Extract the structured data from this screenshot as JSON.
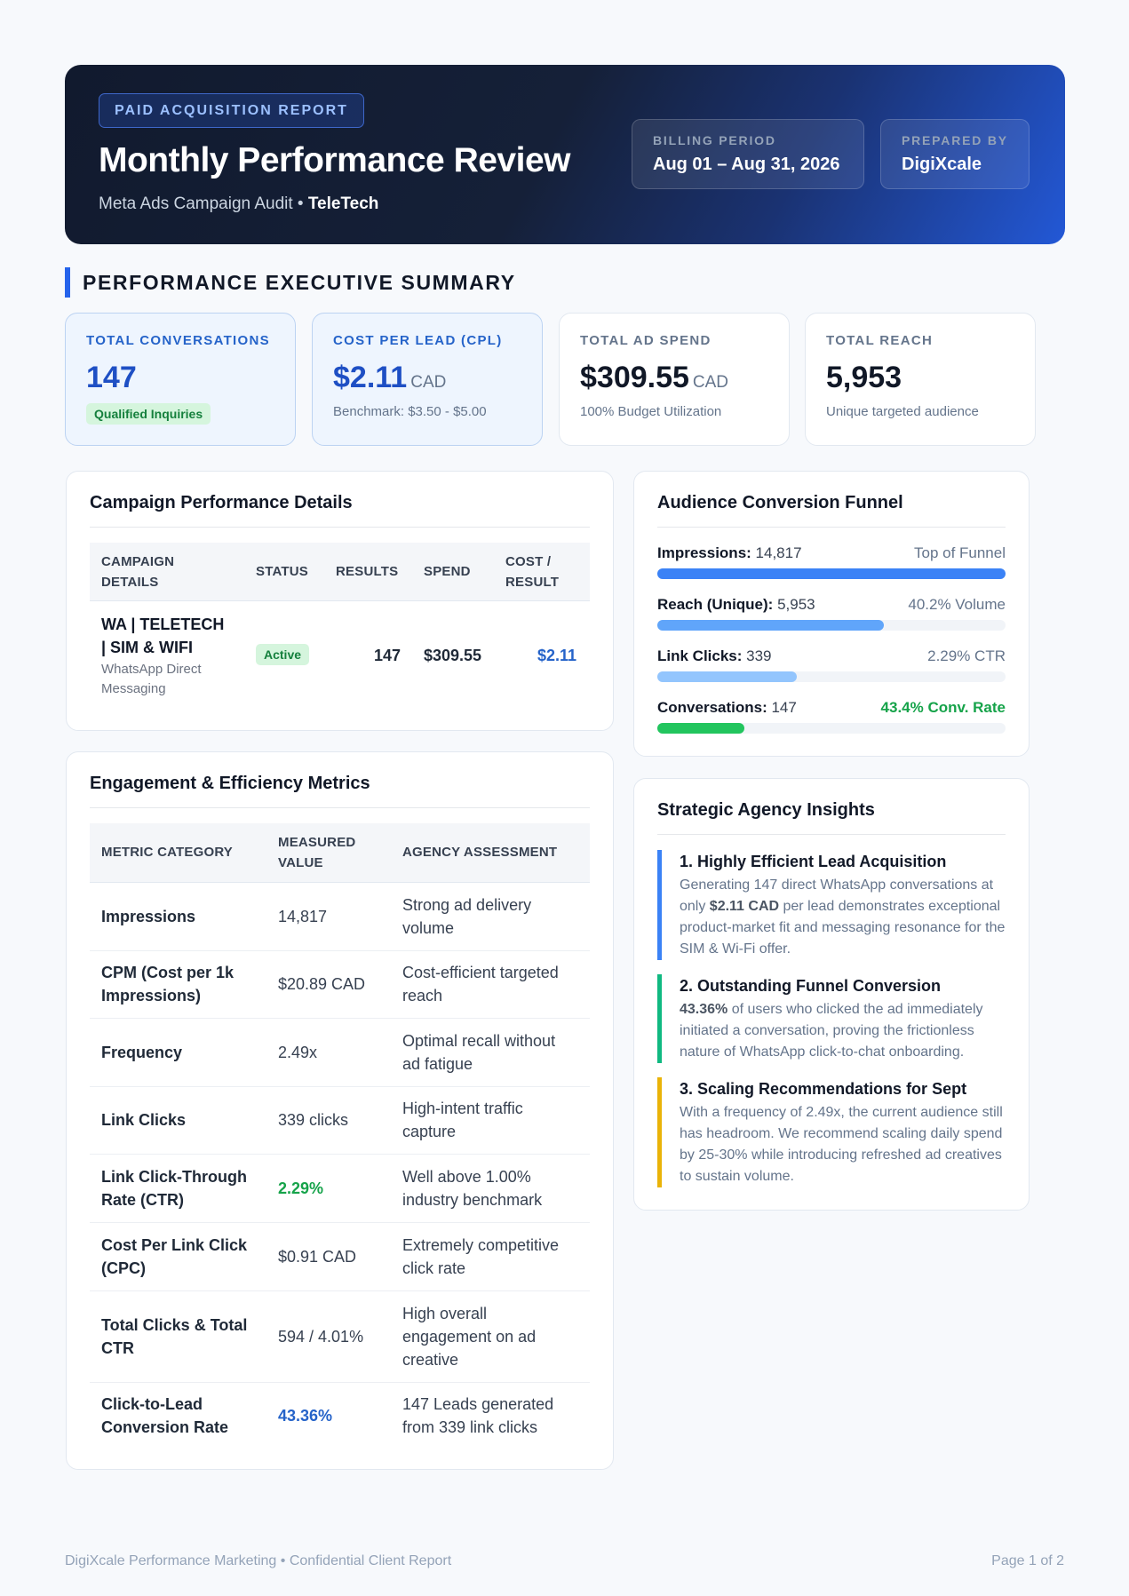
{
  "header": {
    "badge": "PAID ACQUISITION REPORT",
    "title": "Monthly Performance Review",
    "subtitle_prefix": "Meta Ads Campaign Audit • ",
    "subtitle_client": "TeleTech",
    "billing_label": "BILLING PERIOD",
    "billing_value": "Aug 01 – Aug 31, 2026",
    "prepared_label": "PREPARED BY",
    "prepared_value": "DigiXcale"
  },
  "summary": {
    "title": "PERFORMANCE EXECUTIVE SUMMARY",
    "kpis": [
      {
        "label": "TOTAL CONVERSATIONS",
        "value": "147",
        "unit": "",
        "note": "Qualified Inquiries"
      },
      {
        "label": "COST PER LEAD (CPL)",
        "value": "$2.11",
        "unit": "CAD",
        "note": "Benchmark: $3.50 - $5.00"
      },
      {
        "label": "TOTAL AD SPEND",
        "value": "$309.55",
        "unit": "CAD",
        "note": "100% Budget Utilization"
      },
      {
        "label": "TOTAL REACH",
        "value": "5,953",
        "unit": "",
        "note": "Unique targeted audience"
      }
    ]
  },
  "campaign": {
    "title": "Campaign Performance Details",
    "headers": {
      "c1a": "CAMPAIGN",
      "c1b": "DETAILS",
      "c2": "STATUS",
      "c3": "RESULTS",
      "c4": "SPEND",
      "c5a": "COST /",
      "c5b": "RESULT"
    },
    "row": {
      "name_line1": "WA | TELETECH",
      "name_line2": "| SIM & WIFI",
      "desc_line1": "WhatsApp Direct",
      "desc_line2": "Messaging",
      "status": "Active",
      "results": "147",
      "spend": "$309.55",
      "cost": "$2.11"
    }
  },
  "engagement": {
    "title": "Engagement & Efficiency Metrics",
    "headers": {
      "c1": "METRIC CATEGORY",
      "c2a": "MEASURED",
      "c2b": "VALUE",
      "c3": "AGENCY ASSESSMENT"
    },
    "rows": [
      {
        "metric": "Impressions",
        "value": "14,817",
        "assessment": "Strong ad delivery volume"
      },
      {
        "metric": "CPM (Cost per 1k Impressions)",
        "value": "$20.89 CAD",
        "assessment": "Cost-efficient targeted reach"
      },
      {
        "metric": "Frequency",
        "value": "2.49x",
        "assessment": "Optimal recall without ad fatigue"
      },
      {
        "metric": "Link Clicks",
        "value": "339 clicks",
        "assessment": "High-intent traffic capture"
      },
      {
        "metric": "Link Click-Through Rate (CTR)",
        "value": "2.29%",
        "assessment": "Well above 1.00% industry benchmark"
      },
      {
        "metric": "Cost Per Link Click (CPC)",
        "value": "$0.91 CAD",
        "assessment": "Extremely competitive click rate"
      },
      {
        "metric": "Total Clicks & Total CTR",
        "value": "594 / 4.01%",
        "assessment": "High overall engagement on ad creative"
      },
      {
        "metric": "Click-to-Lead Conversion Rate",
        "value": "43.36%",
        "assessment": "147 Leads generated from 339 link clicks"
      }
    ],
    "highlight_green": "#16a34a",
    "highlight_blue": "#2563c9"
  },
  "funnel": {
    "title": "Audience Conversion Funnel",
    "rows": [
      {
        "label": "Impressions:",
        "value": "14,817",
        "right": "Top of Funnel",
        "fill": 1.0,
        "color": "#3b82f6"
      },
      {
        "label": "Reach (Unique):",
        "value": "5,953",
        "right": "40.2% Volume",
        "fill": 0.65,
        "color": "#60a5fa"
      },
      {
        "label": "Link Clicks:",
        "value": "339",
        "right": "2.29% CTR",
        "fill": 0.4,
        "color": "#93c5fd"
      },
      {
        "label": "Conversations:",
        "value": "147",
        "right": "43.4% Conv. Rate",
        "fill": 0.25,
        "color": "#22c55e"
      }
    ]
  },
  "insights": {
    "title": "Strategic Agency Insights",
    "items": [
      {
        "heading": "1. Highly Efficient Lead Acquisition",
        "pre": "Generating 147 direct WhatsApp conversations at only ",
        "bold": "$2.11 CAD",
        "post": " per lead demonstrates exceptional product-market fit and messaging resonance for the SIM & Wi-Fi offer.",
        "color": "#3b82f6"
      },
      {
        "heading": "2. Outstanding Funnel Conversion",
        "pre": "",
        "bold": "43.36%",
        "post": " of users who clicked the ad immediately initiated a conversation, proving the frictionless nature of WhatsApp click-to-chat onboarding.",
        "color": "#10b981"
      },
      {
        "heading": "3. Scaling Recommendations for Sept",
        "pre": "With a frequency of 2.49x, the current audience still has headroom. We recommend scaling daily spend by 25-30% while introducing refreshed ad creatives to sustain volume.",
        "bold": "",
        "post": "",
        "color": "#eab308"
      }
    ]
  },
  "footer": {
    "left": "DigiXcale Performance Marketing • Confidential Client Report",
    "right": "Page 1 of 2"
  }
}
